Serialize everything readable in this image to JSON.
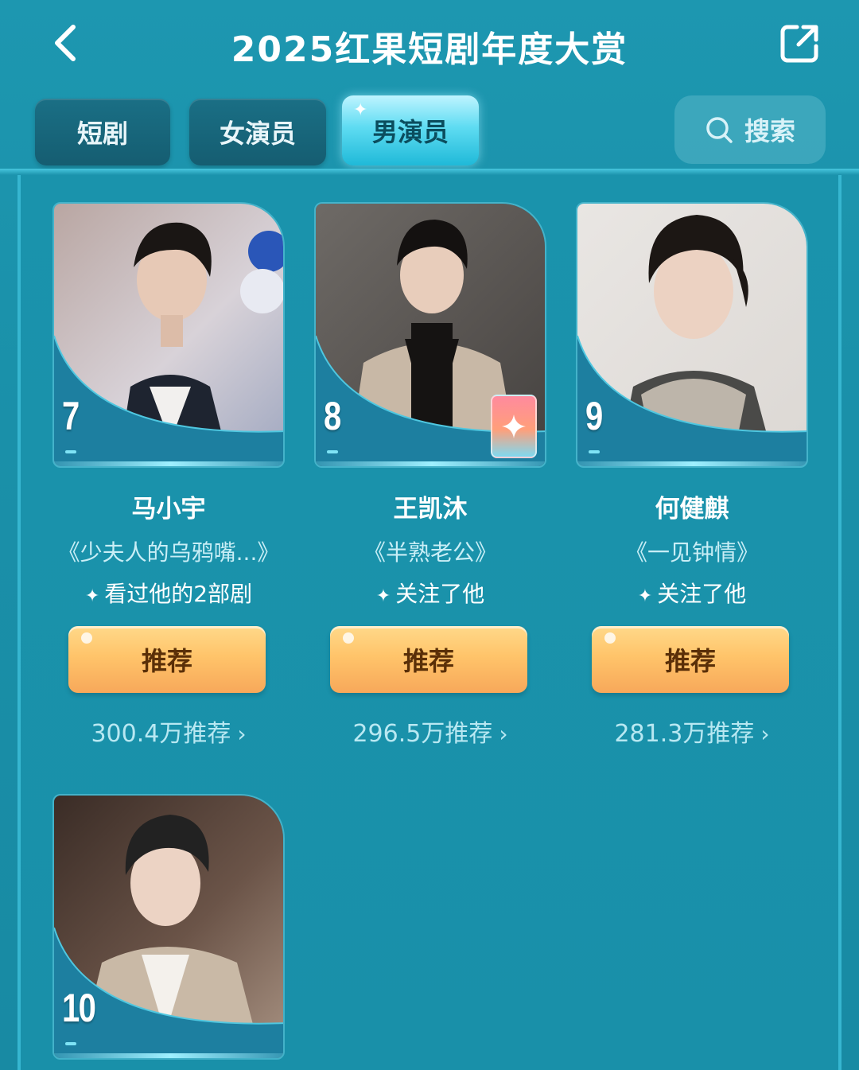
{
  "header": {
    "title": "2025红果短剧年度大赏"
  },
  "tabs": [
    {
      "label": "短剧",
      "active": false
    },
    {
      "label": "女演员",
      "active": false
    },
    {
      "label": "男演员",
      "active": true
    }
  ],
  "search": {
    "label": "搜索"
  },
  "colors": {
    "background": "#1b8fa8",
    "active_tab": "#5fdcf2",
    "button": "#ffc46a"
  },
  "cards": [
    {
      "rank": "7",
      "name": "马小宇",
      "drama": "《少夫人的乌鸦嘴...》",
      "note": "看过他的2部剧",
      "button": "推荐",
      "votes": "300.4万推荐"
    },
    {
      "rank": "8",
      "name": "王凯沐",
      "drama": "《半熟老公》",
      "note": "关注了他",
      "button": "推荐",
      "votes": "296.5万推荐"
    },
    {
      "rank": "9",
      "name": "何健麒",
      "drama": "《一见钟情》",
      "note": "关注了他",
      "button": "推荐",
      "votes": "281.3万推荐"
    },
    {
      "rank": "10"
    }
  ]
}
